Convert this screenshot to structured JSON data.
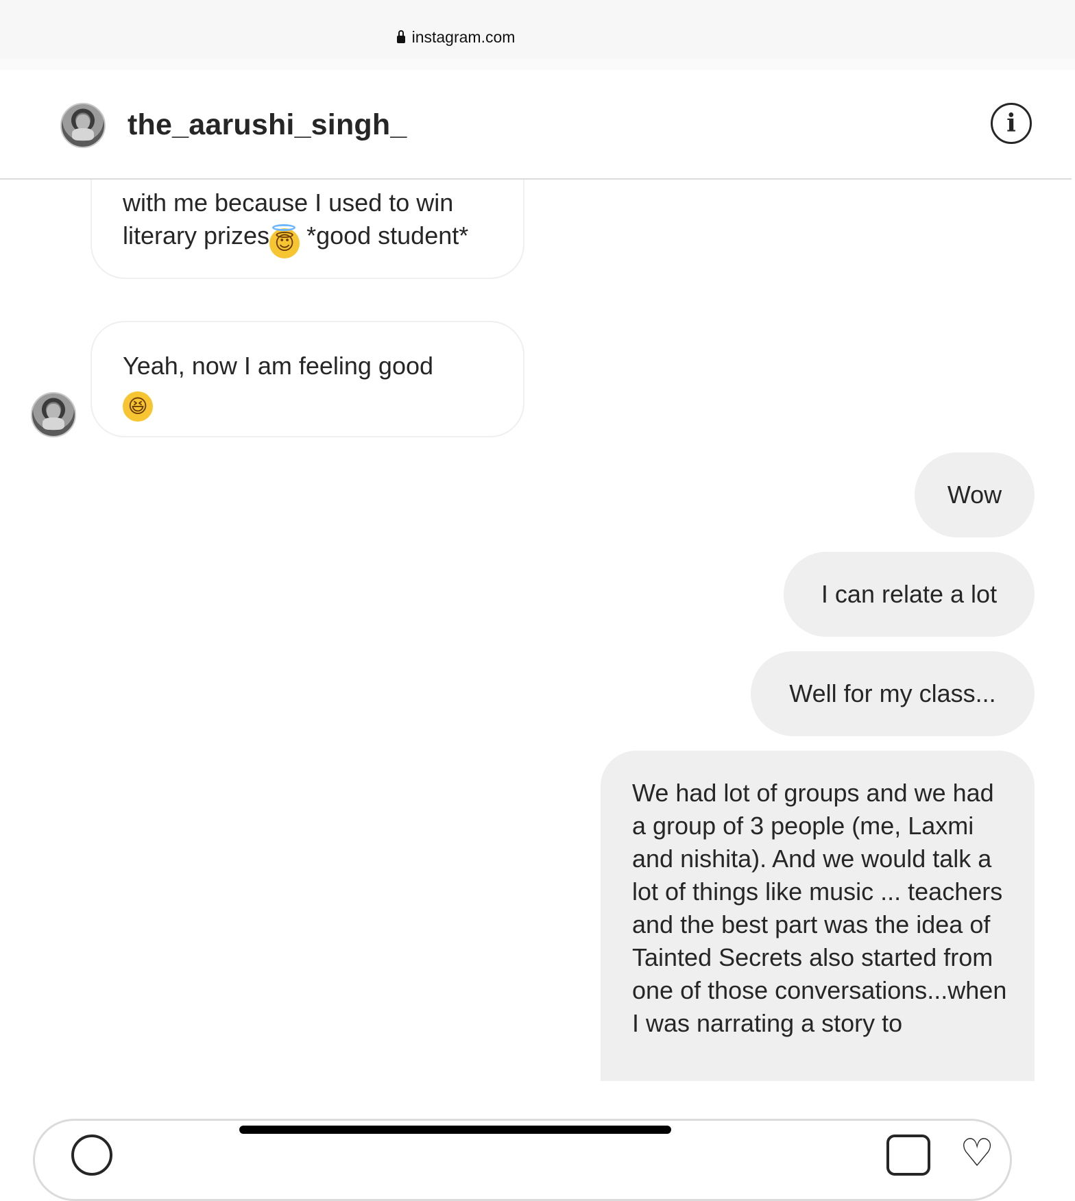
{
  "browser": {
    "url": "instagram.com"
  },
  "header": {
    "username": "the_aarushi_singh_",
    "info_label": "i"
  },
  "messages": {
    "m1": {
      "text": "with me because I used to win literary prizes",
      "tail": " *good student*",
      "emoji": "😇"
    },
    "m2": {
      "text": "Yeah, now I am feeling good ",
      "emoji": "😆"
    },
    "m3": {
      "text": "Wow"
    },
    "m4": {
      "text": "I can relate a lot"
    },
    "m5": {
      "text": "Well for my class..."
    },
    "m6": {
      "text": "We had lot of groups and we had a group of 3 people (me, Laxmi and nishita). And we would talk a lot of things like music ... teachers and the best part was the idea of Tainted Secrets also started from one of those conversations...when I was narrating a story to"
    }
  },
  "icons": {
    "lock": "lock-icon",
    "info": "info-icon",
    "camera": "camera-icon",
    "gallery": "gallery-icon",
    "heart": "heart-icon"
  }
}
